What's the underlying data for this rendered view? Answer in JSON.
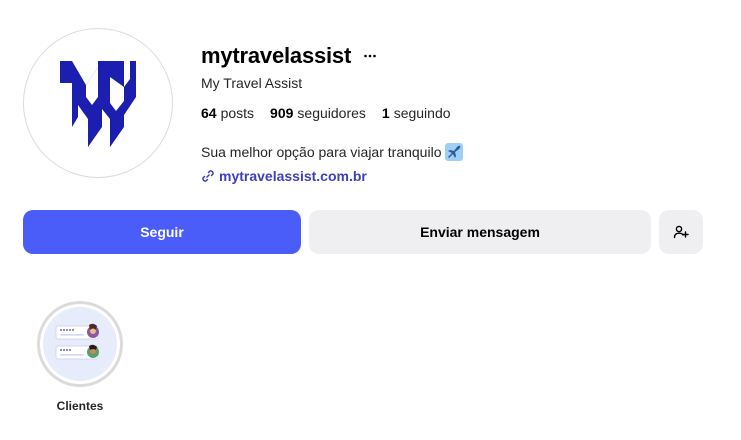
{
  "profile": {
    "username": "mytravelassist",
    "display_name": "My Travel Assist",
    "logo_color": "#1b1eae",
    "stats": [
      {
        "value": "64",
        "label": "posts"
      },
      {
        "value": "909",
        "label": "seguidores"
      },
      {
        "value": "1",
        "label": "seguindo"
      }
    ],
    "bio": "Sua melhor opção para viajar tranquilo",
    "bio_emoji": "airplane-emoji",
    "link": "mytravelassist.com.br"
  },
  "actions": {
    "follow_label": "Seguir",
    "message_label": "Enviar mensagem",
    "follow_color": "#4a5df9",
    "secondary_color": "#efeff2"
  },
  "highlights": [
    {
      "label": "Clientes",
      "icon": "chat-list-icon"
    }
  ]
}
